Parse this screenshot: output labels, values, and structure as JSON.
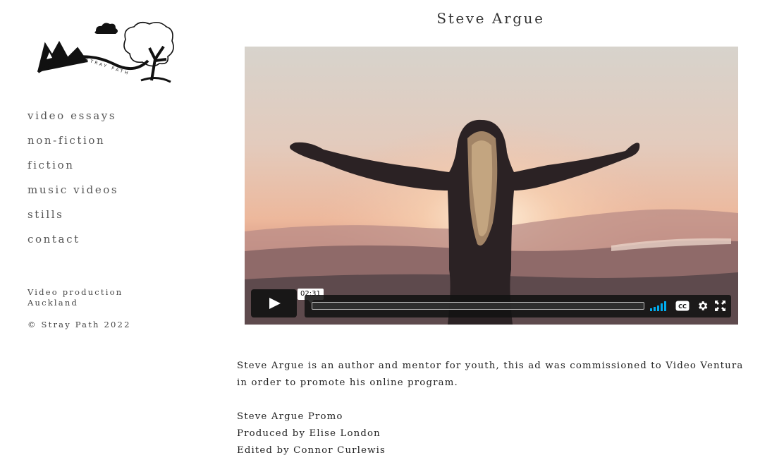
{
  "brand": {
    "logo_text": "STRAY PATH",
    "logo_icon": "stray-path-logo-icon"
  },
  "nav": {
    "items": [
      {
        "label": "video essays"
      },
      {
        "label": "non-fiction"
      },
      {
        "label": "fiction"
      },
      {
        "label": "music videos"
      },
      {
        "label": "stills"
      },
      {
        "label": "contact"
      }
    ]
  },
  "sidebar": {
    "info_line1": "Video production",
    "info_line2": "Auckland",
    "copyright": "© Stray Path 2022"
  },
  "main": {
    "title": "Steve Argue",
    "description": "Steve Argue is an author and mentor for youth, this ad was commissioned to Video Ventura in order to promote his online program.",
    "credits": [
      "Steve Argue Promo",
      "Produced by Elise London",
      "Edited by Connor Curlewis"
    ]
  },
  "player": {
    "duration": "02:31",
    "progress": 0,
    "icons": {
      "play": "play-icon",
      "volume": "volume-icon",
      "captions": "closed-captions-icon",
      "settings": "gear-icon",
      "fullscreen": "fullscreen-icon"
    },
    "accent_color": "#00adef"
  }
}
